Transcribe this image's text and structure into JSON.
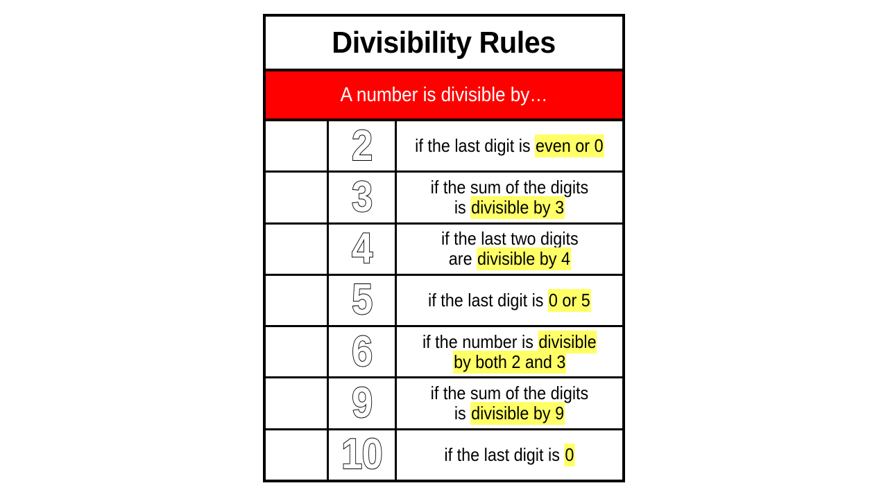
{
  "poster": {
    "title": "Divisibility Rules",
    "subtitle": "A number is divisible by…",
    "colors": {
      "subtitle_band": "#FF0000",
      "highlight": "#FFFF66",
      "border": "#000000",
      "page_background": "#FFFFFF",
      "subtitle_text": "#FFFFFF",
      "digit_fill": "#FFFFFF",
      "digit_outline": "#000000"
    },
    "columns": [
      "",
      "divisor",
      "rule"
    ],
    "rows": [
      {
        "divisor": "2",
        "rule_full": "if the last digit is even or 0",
        "plain_prefix": "if the last digit is ",
        "highlighted": "even or 0",
        "plain_suffix": "",
        "lines": 1
      },
      {
        "divisor": "3",
        "rule_full": "if the sum of the digits is divisible by 3",
        "plain_prefix": "if the sum of the digits\nis ",
        "highlighted": "divisible by 3",
        "plain_suffix": "",
        "lines": 2
      },
      {
        "divisor": "4",
        "rule_full": "if the last two digits are divisible by 4",
        "plain_prefix": "if the last two digits\nare ",
        "highlighted": "divisible by 4",
        "plain_suffix": "",
        "lines": 2
      },
      {
        "divisor": "5",
        "rule_full": "if the last digit is 0 or 5",
        "plain_prefix": "if the last digit is ",
        "highlighted": "0 or 5",
        "plain_suffix": "",
        "lines": 1
      },
      {
        "divisor": "6",
        "rule_full": "if the number is divisible by both 2 and 3",
        "plain_prefix": "if the number is ",
        "highlighted": "divisible\nby both 2 and 3",
        "plain_suffix": "",
        "lines": 2
      },
      {
        "divisor": "9",
        "rule_full": "if the sum of the digits is divisible by 9",
        "plain_prefix": "if the sum of the digits\nis ",
        "highlighted": "divisible by 9",
        "plain_suffix": "",
        "lines": 2
      },
      {
        "divisor": "10",
        "rule_full": "if the last digit is 0",
        "plain_prefix": "if the last digit is ",
        "highlighted": "0",
        "plain_suffix": "",
        "lines": 1
      }
    ]
  }
}
